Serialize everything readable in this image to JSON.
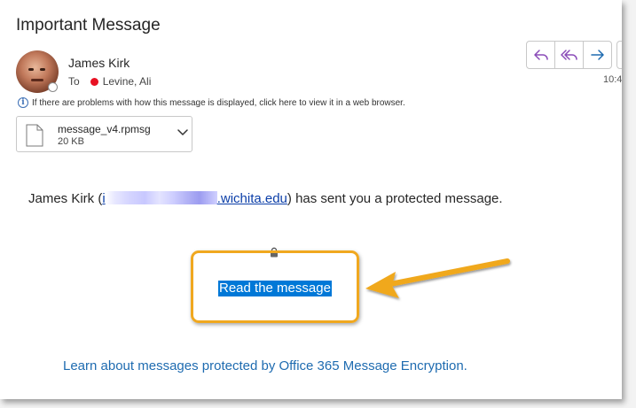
{
  "message": {
    "subject": "Important Message",
    "sender_name": "James Kirk",
    "to_label": "To",
    "recipient": "Levine, Ali",
    "time": "10:4",
    "info_text": "If there are problems with how this message is displayed, click here to view it in a web browser."
  },
  "attachment": {
    "file_name": "message_v4.rpmsg",
    "file_size": "20 KB"
  },
  "body": {
    "intro_prefix": "James Kirk (",
    "email_start": "i",
    "email_end": ".wichita.edu",
    "intro_suffix": ") has sent you a protected message.",
    "read_link": "Read the message",
    "learn_link": "Learn about messages protected by Office 365 Message Encryption."
  },
  "icons": {
    "reply": "reply-icon",
    "reply_all": "reply-all-icon",
    "forward": "forward-icon",
    "info": "info-icon",
    "file": "file-icon",
    "chevron": "chevron-down-icon",
    "lock": "lock-icon",
    "arrow": "callout-arrow-icon"
  },
  "colors": {
    "accent_purple": "#8a4bb8",
    "accent_blue": "#0078d7",
    "link_blue": "#1e6bb0",
    "highlight_orange": "#f0a81f",
    "presence_red": "#e81123"
  }
}
